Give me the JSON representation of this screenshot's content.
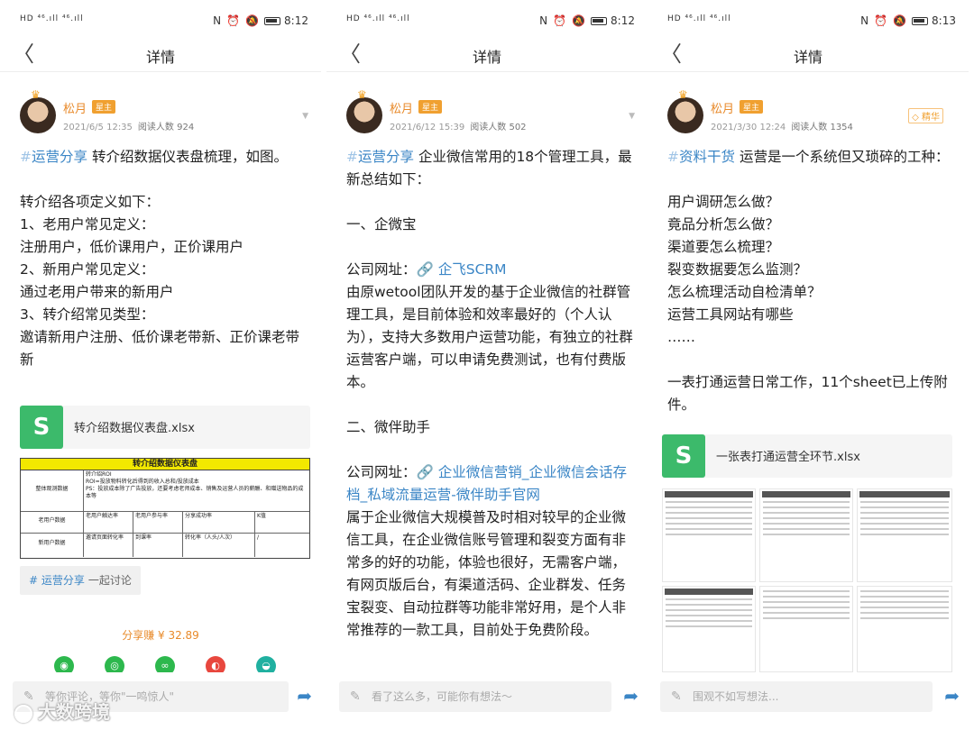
{
  "status": {
    "left": "HD ⁴⁶.ıll ⁴⁶.ıll",
    "times": [
      "8:12",
      "8:12",
      "8:13"
    ]
  },
  "nav": {
    "title": "详情",
    "back": "〈"
  },
  "panels": [
    {
      "author": {
        "name": "松月",
        "badge": "星主",
        "date": "2021/6/5 12:35",
        "reads": "阅读人数 924"
      },
      "tag": "运营分享",
      "intro": " 转介绍数据仪表盘梳理，如图。",
      "lines": [
        "转介绍各项定义如下：",
        "1、老用户常见定义：",
        "注册用户，低价课用户，正价课用户",
        "2、新用户常见定义：",
        "通过老用户带来的新用户",
        "3、转介绍常见类型：",
        "邀请新用户注册、低价课老带新、正价课老带新"
      ],
      "file": {
        "name": "转介绍数据仪表盘.xlsx",
        "icon": "S"
      },
      "sheet": {
        "title": "转介绍数据仪表盘",
        "rows": [
          [
            "整体观测数据",
            "转介绍ROI\nROI=投放物料转化后得到的收入总和/投放成本\nPS：投放成本除了广告投放，还要考虑老师成本、销售及运营人员的薪酬、和赠送物品的成本等"
          ],
          [
            "老用户数据",
            "老用户触达率",
            "老用户参与率",
            "分享成功率",
            "K值"
          ],
          [
            "新用户数据",
            "邀请页面转化率",
            "到课率",
            "转化率（人头/人次）",
            "/"
          ]
        ]
      },
      "topic": {
        "hash": "#",
        "name": "运营分享",
        "action": "一起讨论"
      },
      "share_earn": "分享赚 ¥ 32.89",
      "comment_placeholder": "等你评论，等你\"一鸣惊人\""
    },
    {
      "author": {
        "name": "松月",
        "badge": "星主",
        "date": "2021/6/12 15:39",
        "reads": "阅读人数 502"
      },
      "tag": "运营分享",
      "intro": " 企业微信常用的18个管理工具，最新总结如下：",
      "section1": "一、企微宝",
      "site_label1": "公司网址：",
      "link1": "企飞SCRM",
      "desc1": "由原wetool团队开发的基于企业微信的社群管理工具，是目前体验和效率最好的（个人认为），支持大多数用户运营功能，有独立的社群运营客户端，可以申请免费测试，也有付费版本。",
      "section2": "二、微伴助手",
      "site_label2": "公司网址：",
      "link2": "企业微信营销_企业微信会话存档_私域流量运营-微伴助手官网",
      "desc2": "属于企业微信大规模普及时相对较早的企业微信工具，在企业微信账号管理和裂变方面有非常多的好的功能，体验也很好，无需客户端，有网页版后台，有渠道活码、企业群发、任务宝裂变、自动拉群等功能非常好用，是个人非常推荐的一款工具，目前处于免费阶段。",
      "comment_placeholder": "看了这么多，可能你有想法～"
    },
    {
      "author": {
        "name": "松月",
        "badge": "星主",
        "date": "2021/3/30 12:24",
        "reads": "阅读人数 1354",
        "essence": "精华"
      },
      "tag": "资料干货",
      "intro": " 运营是一个系统但又琐碎的工种：",
      "questions": [
        "用户调研怎么做？",
        "竟品分析怎么做？",
        "渠道要怎么梳理？",
        "裂变数据要怎么监测？",
        "怎么梳理活动自检清单？",
        "运营工具网站有哪些",
        "……"
      ],
      "summary": "一表打通运营日常工作，11个sheet已上传附件。",
      "file": {
        "name": "一张表打通运营全环节.xlsx",
        "icon": "S"
      },
      "comment_placeholder": "围观不如写想法..."
    }
  ],
  "watermark": "大数跨境",
  "colors": {
    "tag": "#3b86c6",
    "author": "#e88a2a",
    "file_icon": "#3cba6b",
    "badge": "#f0a030"
  }
}
